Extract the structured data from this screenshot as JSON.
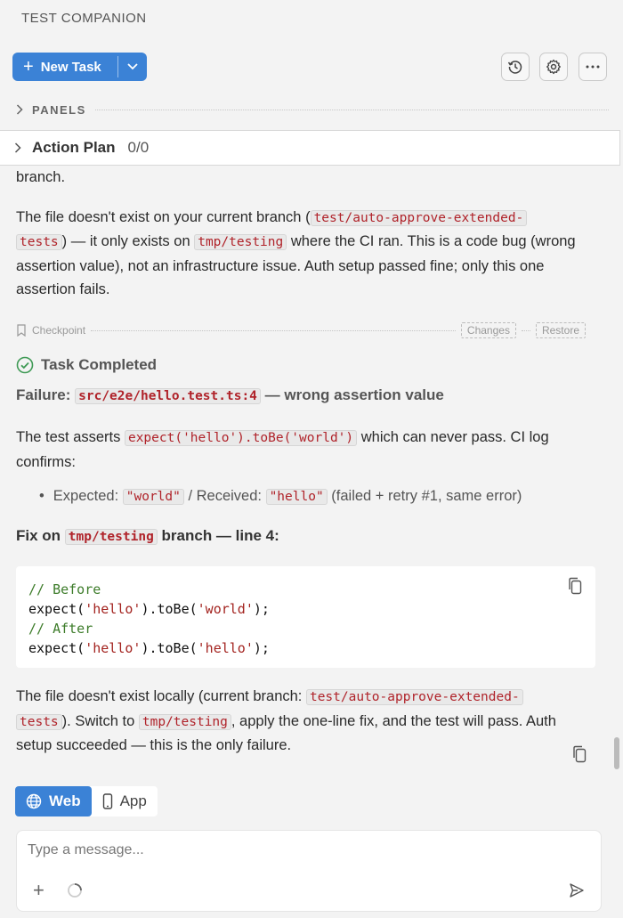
{
  "header": {
    "title": "TEST COMPANION"
  },
  "toolbar": {
    "new_task_label": "New Task",
    "history_icon": "history-icon",
    "settings_icon": "gear-icon",
    "more_icon": "more-icon"
  },
  "panels": {
    "label": "PANELS"
  },
  "action_plan": {
    "title": "Action Plan",
    "count": "0/0"
  },
  "messages": {
    "prev_tail": "branch.",
    "p1": {
      "a": "The file doesn't exist on your current branch (",
      "code1a": "test/auto-approve-extended-",
      "code1b": "tests",
      "b": ") — it only exists on ",
      "code2": "tmp/testing",
      "c": " where the CI ran. This is a code bug (wrong assertion value), not an infrastructure issue. Auth setup passed fine; only this one assertion fails."
    }
  },
  "checkpoint": {
    "label": "Checkpoint",
    "changes": "Changes",
    "restore": "Restore"
  },
  "result": {
    "status": "Task Completed",
    "failure_prefix": "Failure: ",
    "failure_code": "src/e2e/hello.test.ts:4",
    "failure_suffix": " — wrong assertion value",
    "asserts_a": "The test asserts ",
    "asserts_code": "expect('hello').toBe('world')",
    "asserts_b": " which can never pass. CI log confirms:",
    "bullet": {
      "expected_label": "Expected: ",
      "expected_value": "\"world\"",
      "sep": " / Received: ",
      "received_value": "\"hello\"",
      "note": " (failed + retry #1, same error)"
    },
    "fix_prefix": "Fix on ",
    "fix_code": "tmp/testing",
    "fix_suffix": " branch — line 4:",
    "code": {
      "l1": "// Before",
      "l2a": "expect(",
      "l2s1": "'hello'",
      "l2b": ").toBe(",
      "l2s2": "'world'",
      "l2c": ");",
      "l3": "// After",
      "l4a": "expect(",
      "l4s1": "'hello'",
      "l4b": ").toBe(",
      "l4s2": "'hello'",
      "l4c": ");"
    },
    "local": {
      "a": "The file doesn't exist locally (current branch: ",
      "code1a": "test/auto-approve-extended-",
      "code1b": "tests",
      "b": "). Switch to ",
      "code2": "tmp/testing",
      "c": ", apply the one-line fix, and the test will pass. Auth setup succeeded — this is the only failure."
    }
  },
  "modes": {
    "web": "Web",
    "app": "App"
  },
  "composer": {
    "placeholder": "Type a message..."
  }
}
